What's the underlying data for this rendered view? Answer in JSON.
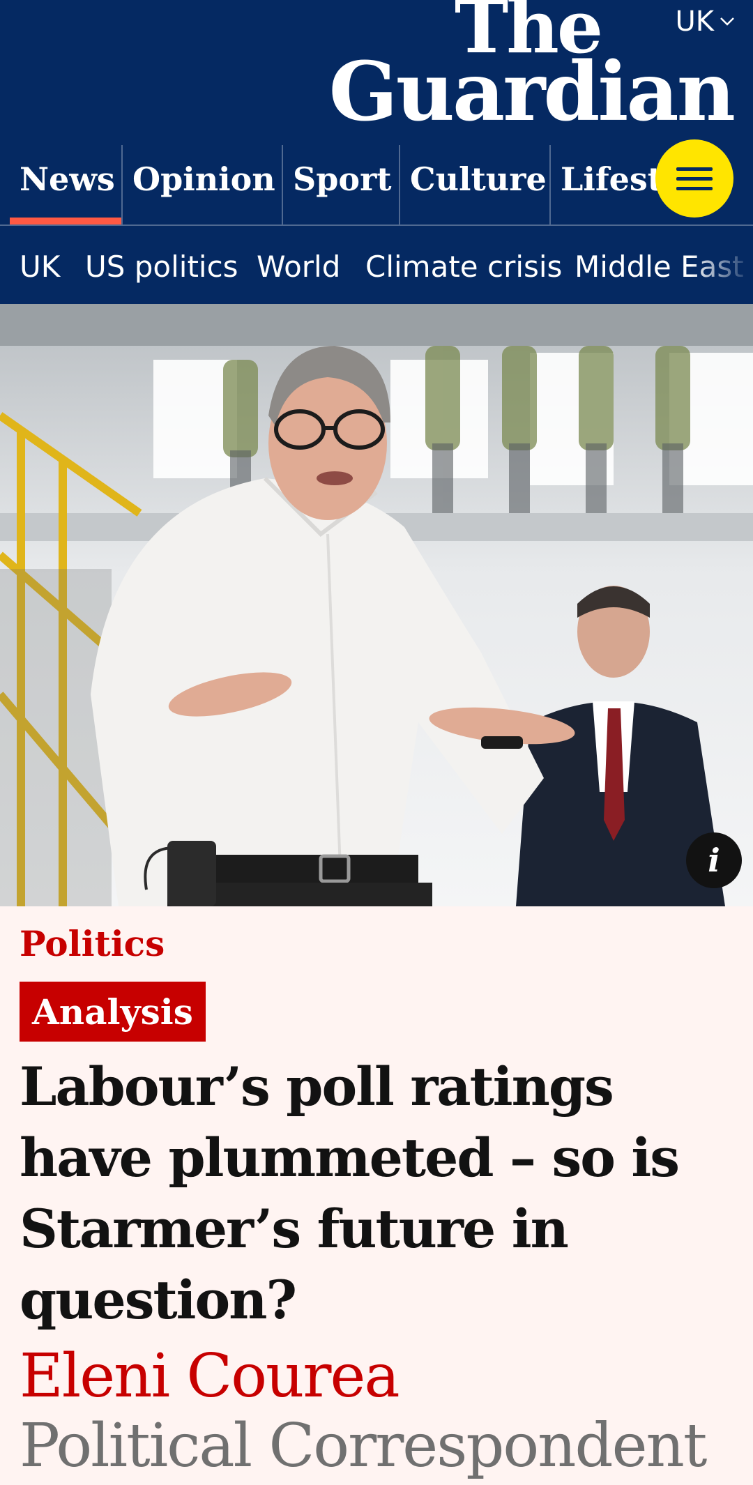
{
  "masthead": {
    "edition": "UK",
    "logo_line1": "The",
    "logo_line2": "Guardian",
    "pillars": [
      "News",
      "Opinion",
      "Sport",
      "Culture",
      "Lifestyle"
    ],
    "active_pillar": "News"
  },
  "subnav": {
    "items": [
      "UK",
      "US politics",
      "World",
      "Climate crisis",
      "Middle East"
    ]
  },
  "hero": {
    "image_icon": "photo-of-man-in-white-shirt-speaking",
    "info_label": "i"
  },
  "article": {
    "section": "Politics",
    "tag": "Analysis",
    "headline": "Labour’s poll ratings have plummeted – so is Starmer’s future in question?",
    "byline": "Eleni Courea",
    "role": "Political Correspondent"
  },
  "colors": {
    "brand_blue": "#052962",
    "accent_red": "#c70000",
    "active_underline": "#ff5943",
    "menu_yellow": "#ffe500",
    "page_bg": "#fff4f2"
  }
}
